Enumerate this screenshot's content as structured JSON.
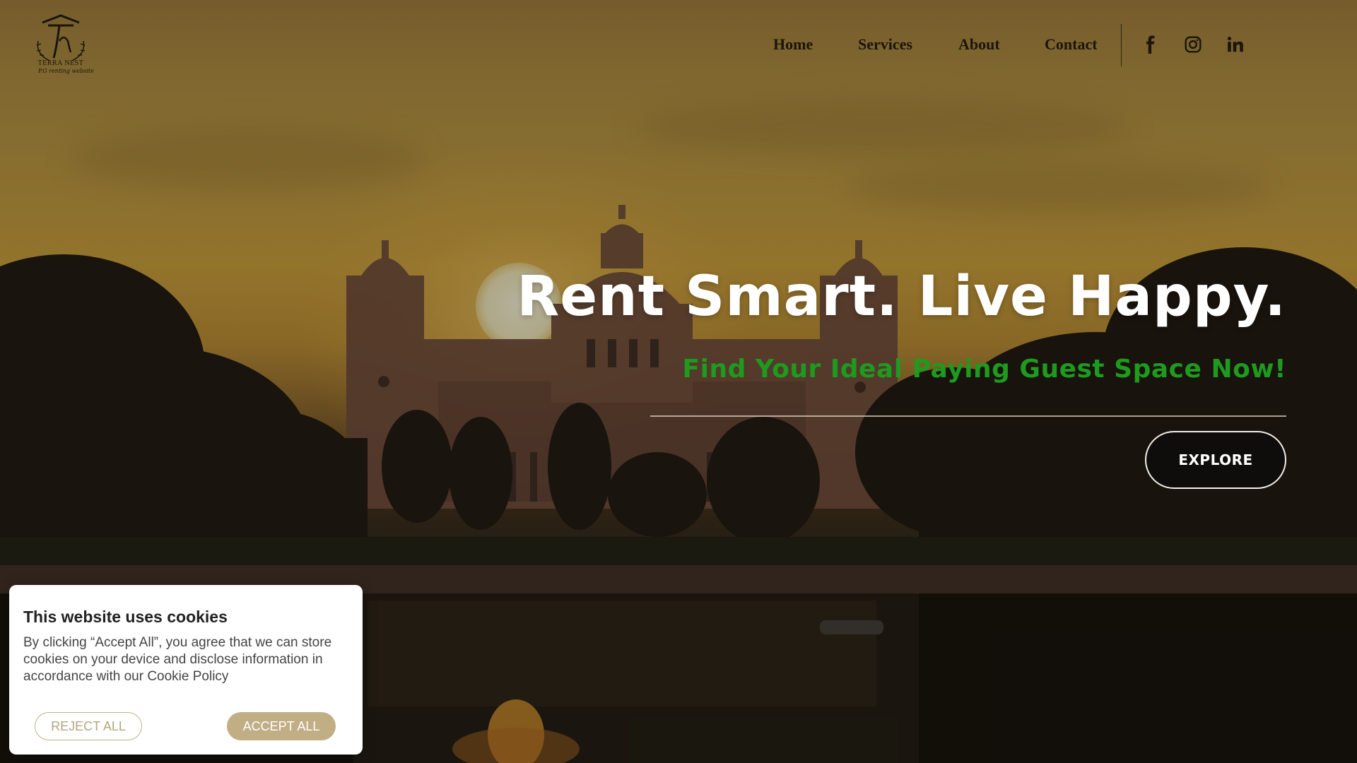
{
  "header": {
    "logo": {
      "name": "logo-icon",
      "brand_text": "TERRA NEST",
      "tagline": "P.G renting website"
    },
    "nav": [
      {
        "label": "Home"
      },
      {
        "label": "Services"
      },
      {
        "label": "About"
      },
      {
        "label": "Contact"
      }
    ],
    "social": [
      {
        "icon": "facebook-icon"
      },
      {
        "icon": "instagram-icon"
      },
      {
        "icon": "linkedin-icon"
      }
    ]
  },
  "hero": {
    "title": "Rent Smart. Live Happy.",
    "subtitle": "Find Your Ideal Paying Guest Space Now!",
    "cta_label": "EXPLORE",
    "subtitle_color": "#1e9a1e"
  },
  "cookie_banner": {
    "title": "This website uses cookies",
    "body": "By clicking “Accept All”, you agree that we can store cookies on your device and disclose information in accordance with our Cookie Policy",
    "reject_label": "REJECT ALL",
    "accept_label": "ACCEPT ALL",
    "accent_color": "#c2ae84"
  }
}
